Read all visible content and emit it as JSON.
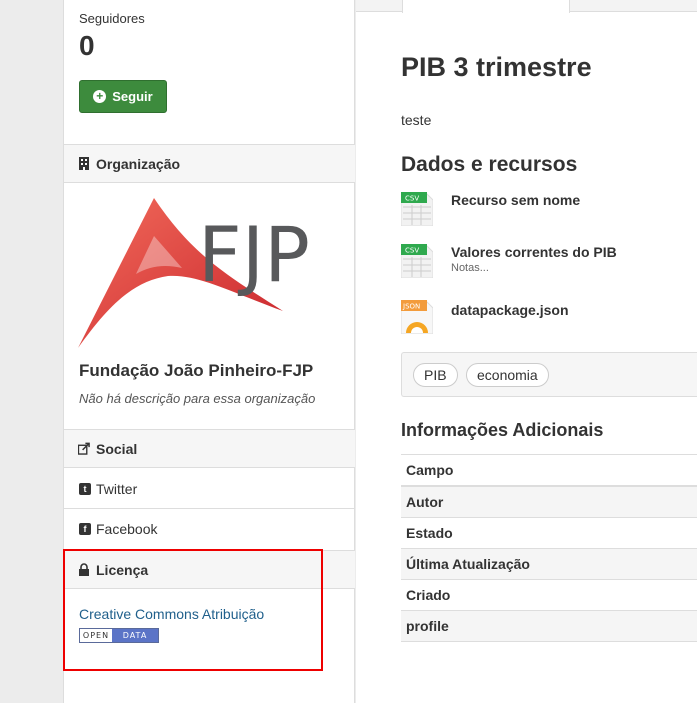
{
  "sidebar": {
    "followers_label": "Seguidores",
    "followers_count": "0",
    "follow_button": "Seguir",
    "organization_heading": "Organização",
    "org_logo_text": "FJP",
    "org_name": "Fundação João Pinheiro-FJP",
    "org_description": "Não há descrição para essa organização",
    "social_heading": "Social",
    "social_items": [
      "Twitter",
      "Facebook"
    ],
    "license_heading": "Licença",
    "license_link": "Creative Commons Atribuição",
    "badge_left": "OPEN",
    "badge_right": "DATA"
  },
  "main": {
    "title": "PIB 3 trimestre",
    "description": "teste",
    "resources_heading": "Dados e recursos",
    "resources": [
      {
        "name": "Recurso sem nome",
        "note": "",
        "format": "CSV"
      },
      {
        "name": "Valores correntes do PIB",
        "note": "Notas...",
        "format": "CSV"
      },
      {
        "name": "datapackage.json",
        "note": "",
        "format": "JSON"
      }
    ],
    "tags": [
      "PIB",
      "economia"
    ],
    "additional_heading": "Informações Adicionais",
    "table_header": "Campo",
    "table_rows": [
      "Autor",
      "Estado",
      "Última Atualização",
      "Criado",
      "profile"
    ]
  },
  "colors": {
    "follow_button": "#3d8b3d",
    "link": "#1f5f8b",
    "highlight": "#ee0000",
    "logo_red": "#e8473f"
  }
}
